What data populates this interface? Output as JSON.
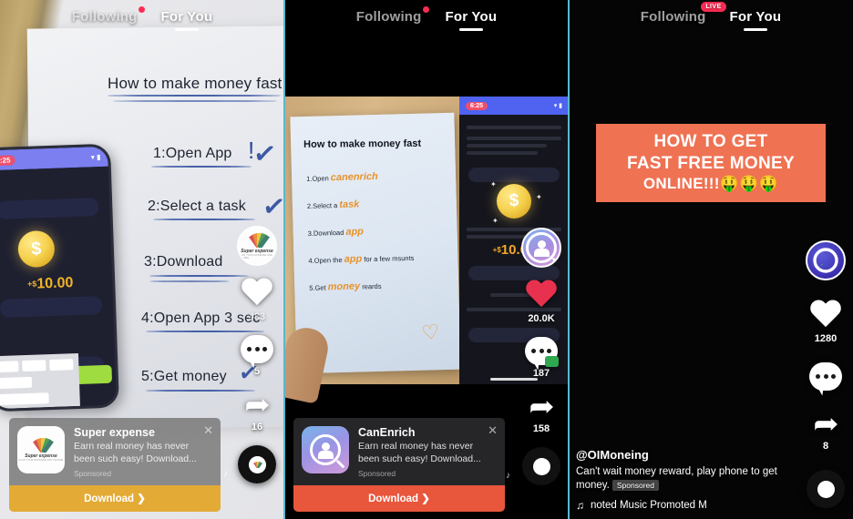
{
  "app": {
    "name": "TikTok feed"
  },
  "panels": [
    {
      "id": "panel-1",
      "tabs": {
        "following": "Following",
        "for_you": "For You",
        "active": "For You",
        "badge": "dot"
      },
      "video": {
        "headline": "How to make money fast",
        "steps": [
          "1:Open App",
          "2:Select a task",
          "3:Download",
          "4:Open App 3 sec",
          "5:Get money"
        ],
        "phone": {
          "time": "6:25",
          "amount": "10.00",
          "amount_prefix": "+$"
        }
      },
      "rail": {
        "like_count": "483",
        "comment_count": "5",
        "share_count": "16"
      },
      "ad": {
        "title": "Super expense",
        "description": "Earn real money has never been such easy! Download...",
        "sponsored_label": "Sponsored",
        "cta": "Download  ❯",
        "close": "✕",
        "logo_name": "super-expense-logo",
        "logo_text": "Super expense",
        "logo_subtext": "PLAN YOUR EXPENSE AND INCOME",
        "card_bg": "#7a7a7a",
        "cta_bg": "#e3ab36"
      }
    },
    {
      "id": "panel-2",
      "tabs": {
        "following": "Following",
        "for_you": "For You",
        "active": "For You",
        "badge": "dot"
      },
      "video": {
        "headline": "How to make money fast",
        "steps": [
          {
            "num": "1.Open",
            "hand": "canenrich"
          },
          {
            "num": "2.Select a",
            "hand": "task"
          },
          {
            "num": "3.Download",
            "hand": "app"
          },
          {
            "num": "4.Open the",
            "hand": "app",
            "tail": "for a few msunts"
          },
          {
            "num": "5.Get",
            "hand": "money",
            "tail": "reards"
          }
        ],
        "phone": {
          "time": "6:25",
          "amount": "10.00",
          "amount_prefix": "+$"
        }
      },
      "rail": {
        "like_count": "20.0K",
        "comment_count": "187",
        "share_count": "158"
      },
      "ad": {
        "title": "CanEnrich",
        "description": "Earn real money has never been such easy! Download...",
        "sponsored_label": "Sponsored",
        "cta": "Download  ❯",
        "close": "✕",
        "logo_name": "canenrich-logo",
        "card_bg": "#28282a",
        "cta_bg": "#e8563c"
      }
    },
    {
      "id": "panel-3",
      "tabs": {
        "following": "Following",
        "for_you": "For You",
        "active": "For You",
        "badge": "LIVE"
      },
      "video": {
        "banner_lines": [
          "HOW TO GET",
          "FAST FREE MONEY",
          "ONLINE!!!"
        ],
        "banner_emojis": "🤑🤑🤑",
        "banner_color": "#ef7253"
      },
      "rail": {
        "like_count": "1280",
        "share_count": "8"
      },
      "caption": {
        "username": "@OIMoneing",
        "description": "Can't wait money reward, play phone to get money.",
        "sponsored_label": "Sponsored",
        "music": "noted Music    Promoted M"
      }
    }
  ]
}
